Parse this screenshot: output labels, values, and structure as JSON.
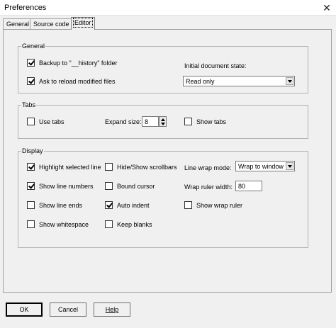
{
  "window": {
    "title": "Preferences",
    "close_glyph": "✕"
  },
  "tabs": [
    {
      "label": "General"
    },
    {
      "label": "Source code"
    },
    {
      "label": "Editor"
    }
  ],
  "general_group": {
    "title": "General",
    "backup": {
      "label": "Backup to \"__history\" folder",
      "checked": true
    },
    "reload": {
      "label": "Ask to reload modified files",
      "checked": true
    },
    "initial_state_label": "Initial document state:",
    "initial_state_value": "Read only"
  },
  "tabs_group": {
    "title": "Tabs",
    "use_tabs": {
      "label": "Use tabs",
      "checked": false
    },
    "expand_size_label": "Expand size:",
    "expand_size_value": "8",
    "show_tabs": {
      "label": "Show tabs",
      "checked": false
    }
  },
  "display_group": {
    "title": "Display",
    "highlight_line": {
      "label": "Highlight selected line",
      "checked": true
    },
    "show_line_numbers": {
      "label": "Show line numbers",
      "checked": true
    },
    "show_line_ends": {
      "label": "Show line ends",
      "checked": false
    },
    "show_whitespace": {
      "label": "Show whitespace",
      "checked": false
    },
    "hide_show_scrollbars": {
      "label": "Hide/Show scrollbars",
      "checked": false
    },
    "bound_cursor": {
      "label": "Bound cursor",
      "checked": false
    },
    "auto_indent": {
      "label": "Auto indent",
      "checked": true
    },
    "keep_blanks": {
      "label": "Keep blanks",
      "checked": false
    },
    "line_wrap_mode_label": "Line wrap mode:",
    "line_wrap_mode_value": "Wrap to window",
    "wrap_ruler_width_label": "Wrap ruler width:",
    "wrap_ruler_width_value": "80",
    "show_wrap_ruler": {
      "label": "Show wrap ruler",
      "checked": false
    }
  },
  "buttons": {
    "ok": "OK",
    "cancel": "Cancel",
    "help": "Help"
  }
}
